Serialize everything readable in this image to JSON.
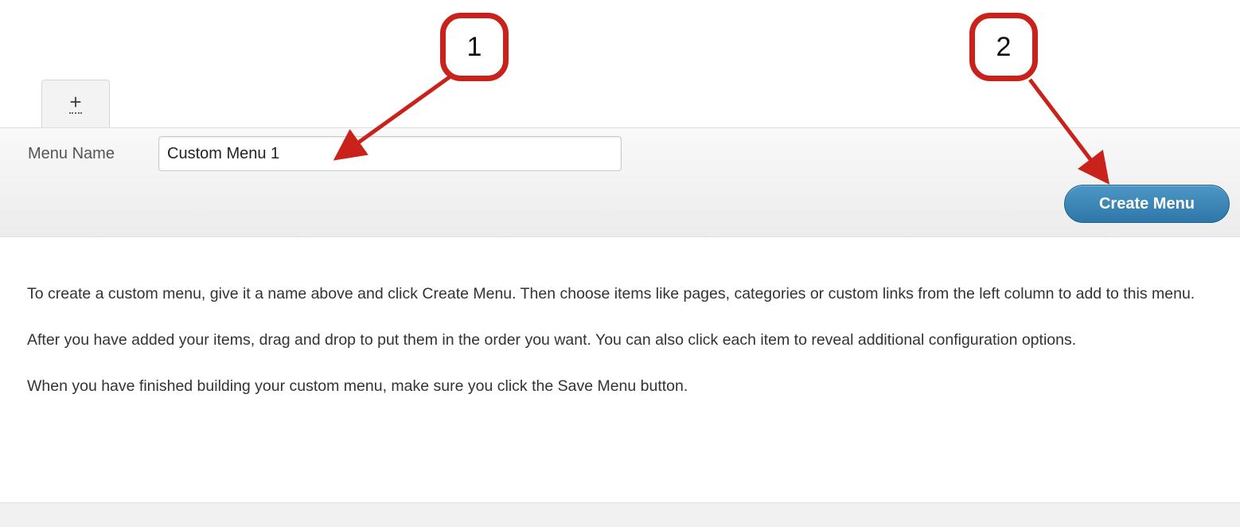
{
  "tabs": {
    "new_tab_icon": "plus-icon",
    "new_tab_glyph": "+"
  },
  "form": {
    "menu_name_label": "Menu Name",
    "menu_name_value": "Custom Menu 1",
    "create_button_label": "Create Menu"
  },
  "instructions": {
    "p1": "To create a custom menu, give it a name above and click Create Menu. Then choose items like pages, categories or custom links from the left column to add to this menu.",
    "p2": "After you have added your items, drag and drop to put them in the order you want. You can also click each item to reveal additional configuration options.",
    "p3": "When you have finished building your custom menu, make sure you click the Save Menu button."
  },
  "annotations": [
    {
      "label": "1"
    },
    {
      "label": "2"
    }
  ],
  "colors": {
    "callout_red": "#c8221b",
    "button_blue": "#2e77a8"
  }
}
